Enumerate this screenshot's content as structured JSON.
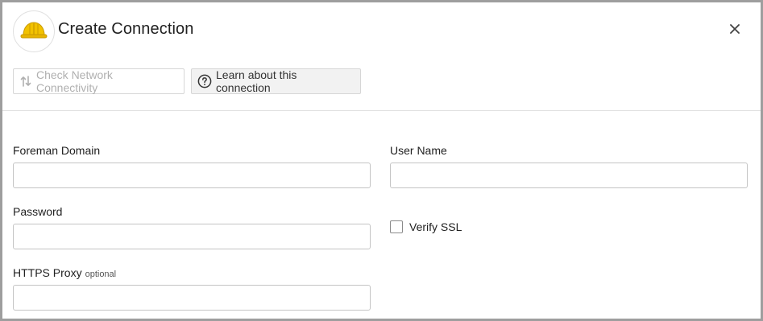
{
  "dialog": {
    "title": "Create Connection",
    "logo_icon": "hard-hat-icon",
    "close_icon": "close-icon"
  },
  "toolbar": {
    "check_label": "Check Network Connectivity",
    "check_enabled": false,
    "check_icon": "network-arrows-icon",
    "learn_label": "Learn about this connection",
    "learn_icon": "help-circle-icon"
  },
  "form": {
    "foreman_domain": {
      "label": "Foreman Domain",
      "value": "",
      "placeholder": ""
    },
    "user_name": {
      "label": "User Name",
      "value": "",
      "placeholder": ""
    },
    "password": {
      "label": "Password",
      "value": "",
      "placeholder": ""
    },
    "verify_ssl": {
      "label": "Verify SSL",
      "checked": false
    },
    "https_proxy": {
      "label": "HTTPS Proxy",
      "optional_tag": "optional",
      "value": "",
      "placeholder": ""
    }
  },
  "colors": {
    "border": "#9e9e9e",
    "hat_yellow": "#f2c200",
    "disabled_text": "#b0b0b0"
  }
}
